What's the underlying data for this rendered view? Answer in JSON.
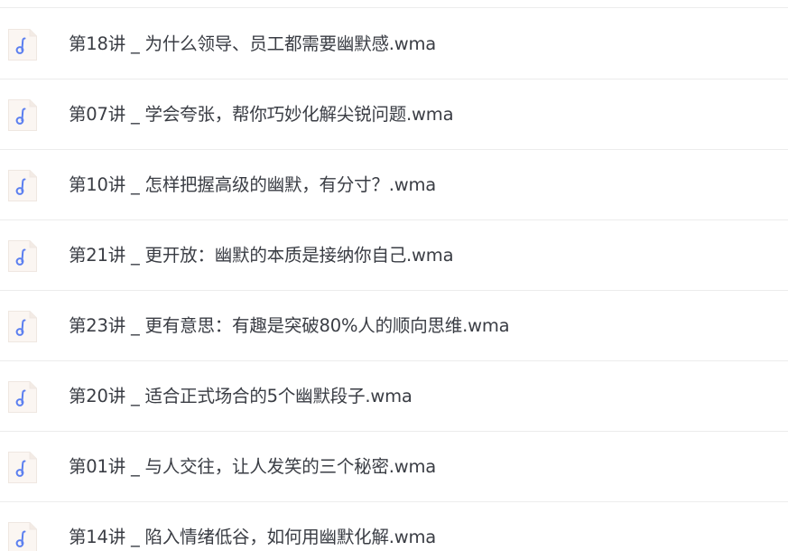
{
  "file_list": {
    "items": [
      {
        "name": "第18讲 _ 为什么领导、员工都需要幽默感.wma",
        "icon": "audio-file-icon"
      },
      {
        "name": "第07讲 _ 学会夸张，帮你巧妙化解尖锐问题.wma",
        "icon": "audio-file-icon"
      },
      {
        "name": "第10讲 _ 怎样把握高级的幽默，有分寸？.wma",
        "icon": "audio-file-icon"
      },
      {
        "name": "第21讲 _ 更开放：幽默的本质是接纳你自己.wma",
        "icon": "audio-file-icon"
      },
      {
        "name": "第23讲 _ 更有意思：有趣是突破80%人的顺向思维.wma",
        "icon": "audio-file-icon"
      },
      {
        "name": "第20讲 _ 适合正式场合的5个幽默段子.wma",
        "icon": "audio-file-icon"
      },
      {
        "name": "第01讲 _ 与人交往，让人发笑的三个秘密.wma",
        "icon": "audio-file-icon"
      },
      {
        "name": "第14讲 _ 陷入情绪低谷，如何用幽默化解.wma",
        "icon": "audio-file-icon"
      }
    ]
  },
  "colors": {
    "icon_fill": "#fbf6f2",
    "icon_border": "#efe7e1",
    "music_note": "#5b7ff0",
    "text": "#3a3d44",
    "divider": "#ececec"
  }
}
